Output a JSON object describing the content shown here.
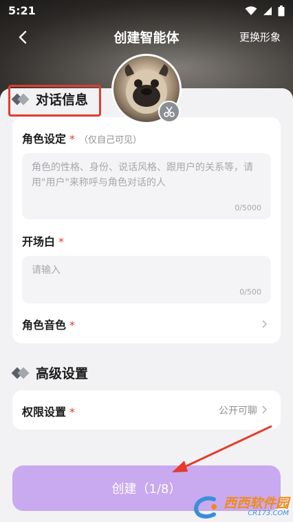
{
  "status": {
    "time": "5:21"
  },
  "header": {
    "title": "创建智能体",
    "change_label": "更换形象"
  },
  "sections": {
    "dialog": {
      "title": "对话信息"
    },
    "advanced": {
      "title": "高级设置"
    }
  },
  "fields": {
    "role": {
      "label": "角色设定",
      "required": "*",
      "hint": "（仅自己可见）",
      "placeholder": "角色的性格、身份、说话风格、跟用户的关系等，请用\"用户\"来称呼与角色对话的人",
      "counter": "0/5000"
    },
    "opening": {
      "label": "开场白",
      "required": "*",
      "placeholder": "请输入",
      "counter": "0/500"
    },
    "voice": {
      "label": "角色音色",
      "required": "*"
    },
    "permission": {
      "label": "权限设置",
      "required": "*",
      "value": "公开可聊"
    }
  },
  "create_button": {
    "label": "创建（1/8）"
  },
  "watermark": {
    "title": "西西软件园",
    "sub": "CR173.COM"
  },
  "colors": {
    "accent": "#c9a9f0",
    "required": "#e53b2c",
    "highlight": "#e53b2c"
  }
}
